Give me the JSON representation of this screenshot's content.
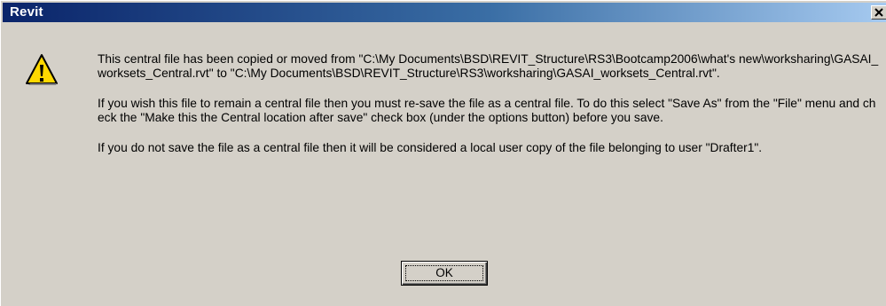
{
  "window": {
    "title": "Revit",
    "close_icon": "close-icon"
  },
  "dialog": {
    "icon": "warning-icon",
    "paragraphs": [
      "This central file has been copied or moved from \"C:\\My Documents\\BSD\\REVIT_Structure\\RS3\\Bootcamp2006\\what's new\\worksharing\\GASAI_worksets_Central.rvt\" to \"C:\\My Documents\\BSD\\REVIT_Structure\\RS3\\worksharing\\GASAI_worksets_Central.rvt\".",
      "If you wish this file to remain a central file then you must re-save the file as a central file. To do this select \"Save As\" from the \"File\" menu and check the \"Make this the Central location after save\" check box (under the options button) before you save.",
      "If you do not save the file as a central file then it will be considered a local user copy of the file belonging to user \"Drafter1\"."
    ],
    "ok_label": "OK"
  },
  "colors": {
    "titlebar_start": "#0a246a",
    "titlebar_end": "#a6caf0",
    "dialog_bg": "#d4d0c8",
    "warning_yellow": "#ffd800"
  }
}
